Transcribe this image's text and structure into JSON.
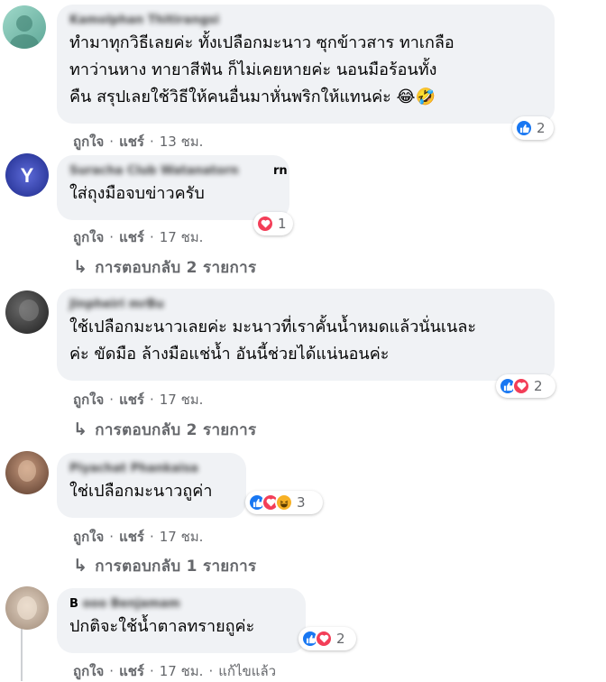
{
  "meta_labels": {
    "like": "ถูกใจ",
    "share": "แชร์",
    "dot": "·"
  },
  "comments": [
    {
      "author_visible": "Kamolphan Thitirangsi",
      "lines": [
        "ทำมาทุกวิธีเลยค่ะ ทั้งเปลือกมะนาว ซุกข้าวสาร ทาเกลือ",
        "ทาว่านหาง ทายาสีฟัน ก็ไม่เคยหายค่ะ นอนมือร้อนทั้ง",
        "คืน สรุปเลยใช้วิธีให้คนอื่นมาหั่นพริกให้แทนค่ะ 😂🤣"
      ],
      "time": "13 ชม.",
      "reaction_count": "2",
      "reactions": [
        "like"
      ],
      "replies": ""
    },
    {
      "author_visible": "rn",
      "author_blur": "Suracha Club Watanatorn",
      "lines": [
        "ใส่ถุงมือจบข่าวครับ"
      ],
      "time": "17 ชม.",
      "reaction_count": "1",
      "reactions": [
        "love"
      ],
      "replies": "การตอบกลับ 2 รายการ"
    },
    {
      "author_blur": "Jinpheiri mrBu",
      "lines": [
        "ใช้เปลือกมะนาวเลยค่ะ มะนาวที่เราคั้นน้ำหมดแล้วนั่นเนละ",
        "ค่ะ ขัดมือ ล้างมือแช่น้ำ อันนี้ช่วยได้แน่นอนค่ะ"
      ],
      "time": "17 ชม.",
      "reaction_count": "2",
      "reactions": [
        "like",
        "love"
      ],
      "replies": "การตอบกลับ 2 รายการ"
    },
    {
      "author_blur": "Piyachat Phankaisa",
      "lines": [
        "ใช่เปลือกมะนาวถูค่า"
      ],
      "time": "17 ชม.",
      "reaction_count": "3",
      "reactions": [
        "like",
        "love",
        "haha"
      ],
      "replies": "การตอบกลับ 1 รายการ"
    },
    {
      "author_visible": "B",
      "author_blur": "ooo Benjamam",
      "lines": [
        "ปกติจะใช้น้ำตาลทรายถูค่ะ"
      ],
      "time": "17 ชม.",
      "edited": "แก้ไขแล้ว",
      "reaction_count": "2",
      "reactions": [
        "like",
        "love"
      ],
      "replies": ""
    }
  ]
}
